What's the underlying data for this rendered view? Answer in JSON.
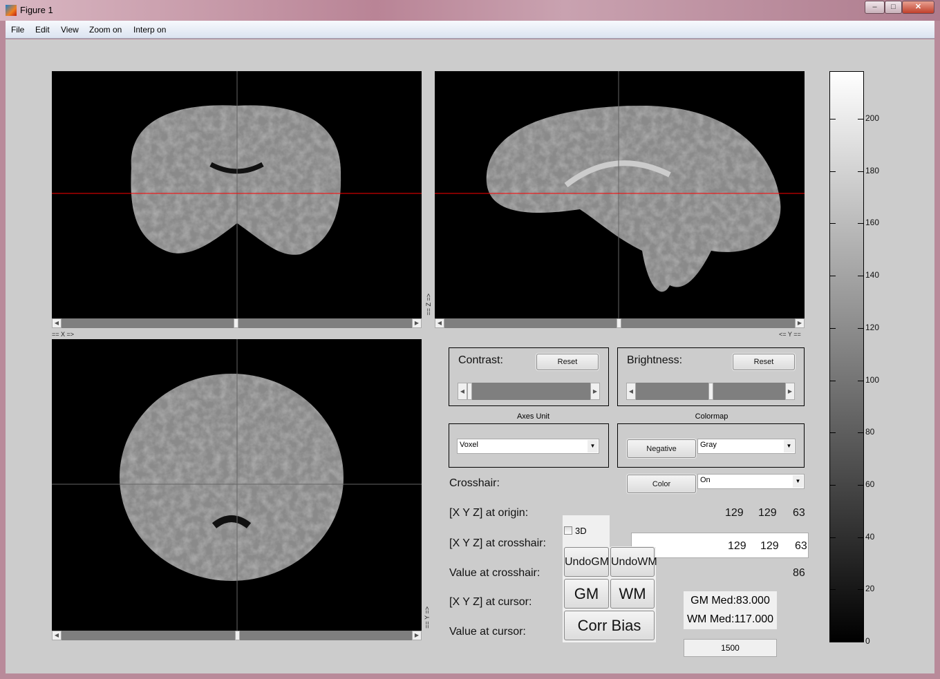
{
  "window": {
    "title": "Figure 1",
    "controls": [
      "minimize",
      "maximize",
      "close"
    ]
  },
  "menu": [
    "File",
    "Edit",
    "View",
    "Zoom on",
    "Interp on"
  ],
  "axes_labels": {
    "x": "== X =>",
    "y_top": "<= Y ==",
    "z": "== Z =>",
    "y_bottom": "== Y =>"
  },
  "crosshair_color": "#ff0000",
  "contrast": {
    "label": "Contrast:",
    "reset": "Reset",
    "slider_value": 0.0
  },
  "brightness": {
    "label": "Brightness:",
    "reset": "Reset",
    "slider_value": 0.5
  },
  "axes_unit": {
    "title": "Axes Unit",
    "selected": "Voxel"
  },
  "colormap": {
    "title": "Colormap",
    "negative": "Negative",
    "selected": "Gray"
  },
  "crosshair": {
    "label": "Crosshair:",
    "color_button": "Color",
    "selected": "On"
  },
  "info": {
    "origin_label": "[X Y Z] at origin:",
    "origin": [
      "129",
      "129",
      "63"
    ],
    "crosshair_label": "[X Y Z] at crosshair:",
    "crosshair": [
      "129",
      "129",
      "63"
    ],
    "value_crosshair_label": "Value at crosshair:",
    "value_crosshair": "86",
    "cursor_label": "[X Y Z] at cursor:",
    "value_cursor_label": "Value at cursor:"
  },
  "tools": {
    "checkbox_3d": "3D",
    "checked_3d": false,
    "undo_gm": "UndoGM",
    "undo_wm": "UndoWM",
    "gm": "GM",
    "wm": "WM",
    "corr_bias": "Corr Bias"
  },
  "stats": {
    "gm_med": "GM Med:83.000",
    "wm_med": "WM Med:117.000",
    "field": "1500"
  },
  "colorbar": {
    "colormap": "gray",
    "range": [
      0,
      218
    ],
    "ticks": [
      "0",
      "20",
      "40",
      "60",
      "80",
      "100",
      "120",
      "140",
      "160",
      "180",
      "200"
    ]
  }
}
